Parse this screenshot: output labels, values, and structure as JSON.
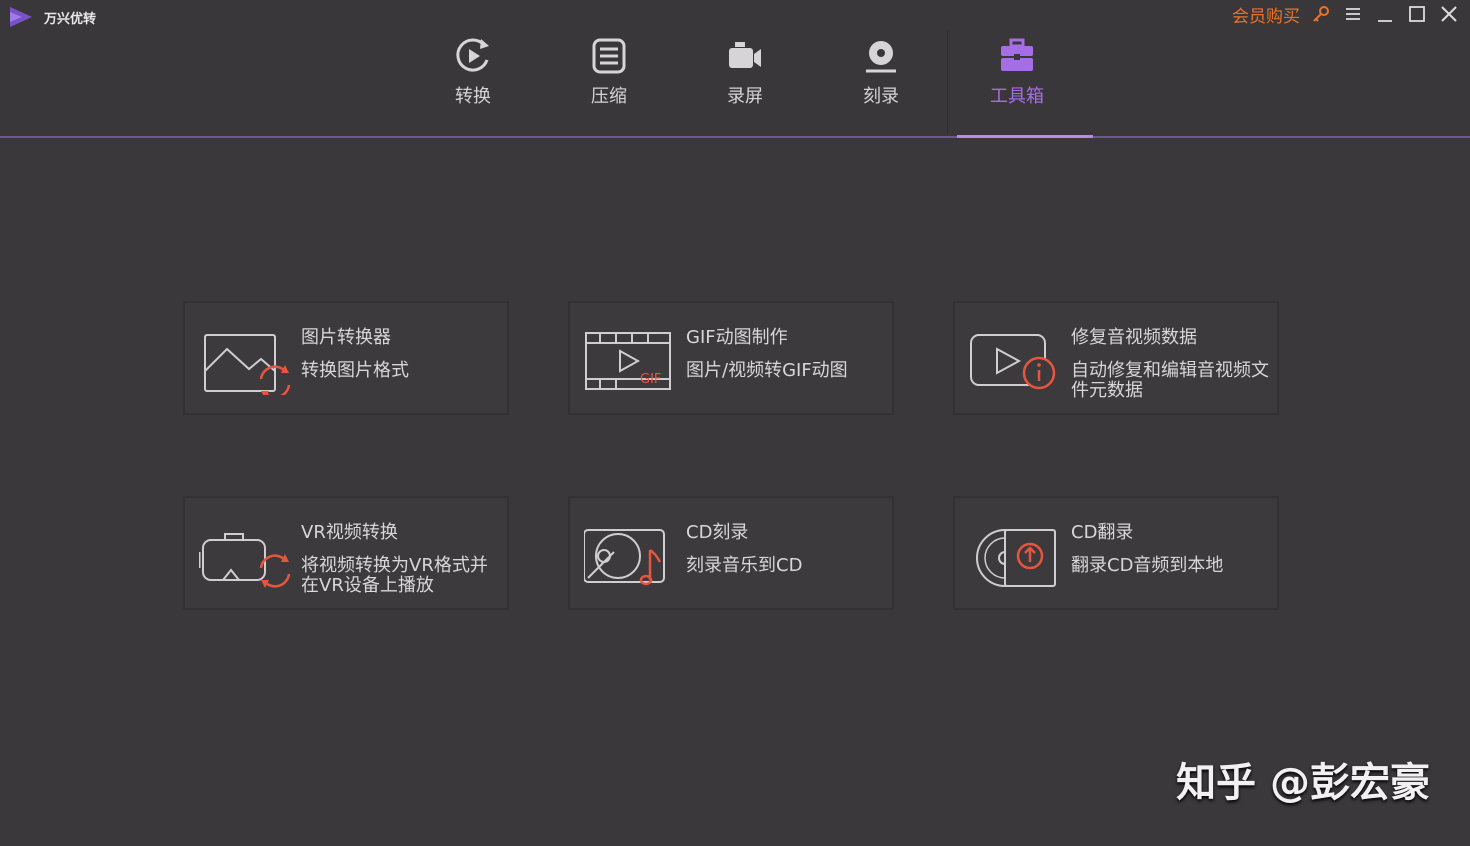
{
  "app": {
    "title": "万兴优转"
  },
  "header": {
    "buy_label": "会员购买"
  },
  "tabs": [
    {
      "label": "转换",
      "icon": "convert-icon"
    },
    {
      "label": "压缩",
      "icon": "compress-icon"
    },
    {
      "label": "录屏",
      "icon": "record-icon"
    },
    {
      "label": "刻录",
      "icon": "burn-icon"
    },
    {
      "label": "工具箱",
      "icon": "toolbox-icon",
      "active": true
    }
  ],
  "tools": [
    {
      "title": "图片转换器",
      "desc": "转换图片格式",
      "icon": "image-convert-icon"
    },
    {
      "title": "GIF动图制作",
      "desc": "图片/视频转GIF动图",
      "icon": "gif-maker-icon"
    },
    {
      "title": "修复音视频数据",
      "desc": "自动修复和编辑音视频文件元数据",
      "icon": "metadata-repair-icon"
    },
    {
      "title": "VR视频转换",
      "desc": "将视频转换为VR格式并在VR设备上播放",
      "icon": "vr-convert-icon"
    },
    {
      "title": "CD刻录",
      "desc": "刻录音乐到CD",
      "icon": "cd-burn-icon"
    },
    {
      "title": "CD翻录",
      "desc": "翻录CD音频到本地",
      "icon": "cd-rip-icon"
    }
  ],
  "watermark": "知乎 @彭宏豪",
  "colors": {
    "accent": "#a56ee6",
    "buy": "#e8742a",
    "icon_red": "#e8553e",
    "background": "#3b383b"
  }
}
